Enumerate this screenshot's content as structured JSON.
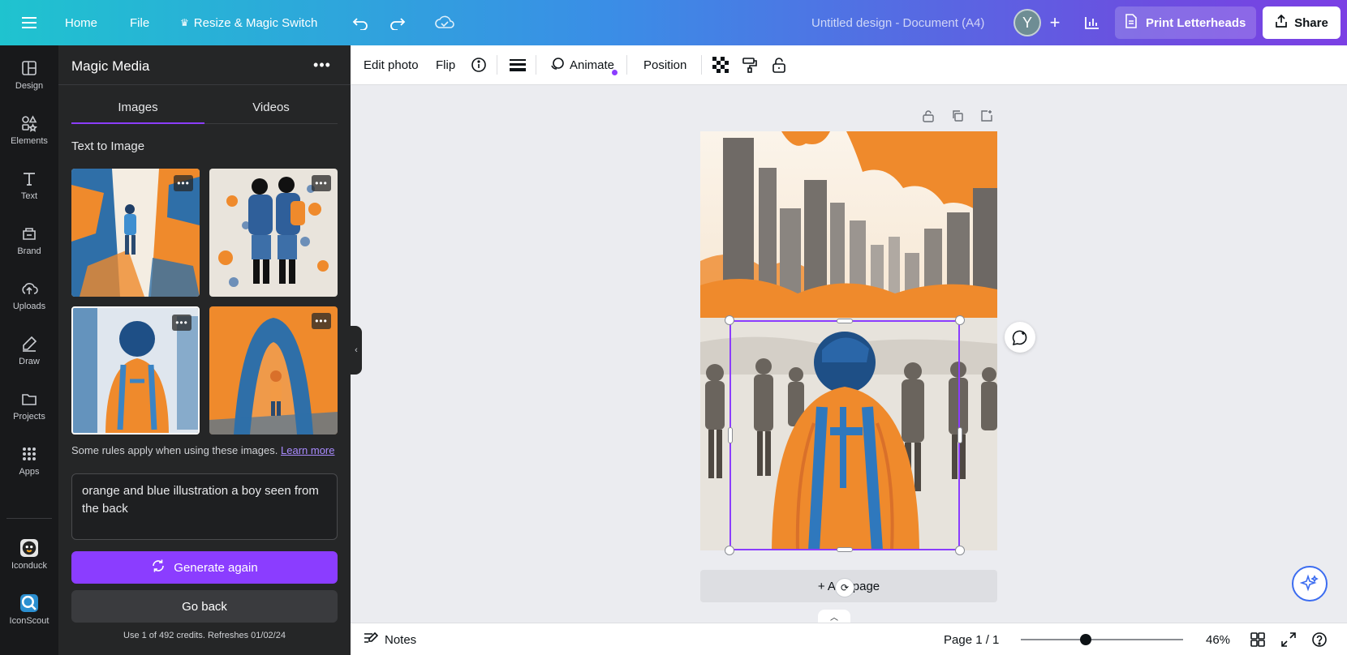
{
  "topbar": {
    "home": "Home",
    "file": "File",
    "resize": "Resize & Magic Switch",
    "doc_title": "Untitled design - Document (A4)",
    "avatar_initial": "Y",
    "print": "Print Letterheads",
    "share": "Share"
  },
  "rail": {
    "items": [
      {
        "label": "Design",
        "icon": "design-icon"
      },
      {
        "label": "Elements",
        "icon": "elements-icon"
      },
      {
        "label": "Text",
        "icon": "text-icon"
      },
      {
        "label": "Brand",
        "icon": "brand-icon"
      },
      {
        "label": "Uploads",
        "icon": "uploads-icon"
      },
      {
        "label": "Draw",
        "icon": "draw-icon"
      },
      {
        "label": "Projects",
        "icon": "projects-icon"
      },
      {
        "label": "Apps",
        "icon": "apps-icon"
      },
      {
        "label": "Iconduck",
        "icon": "iconduck-icon"
      },
      {
        "label": "IconScout",
        "icon": "iconscout-icon"
      }
    ]
  },
  "panel": {
    "title": "Magic Media",
    "tabs": [
      {
        "label": "Images",
        "active": true
      },
      {
        "label": "Videos",
        "active": false
      }
    ],
    "section_title": "Text to Image",
    "rules_text": "Some rules apply when using these images.",
    "rules_link": "Learn more",
    "prompt": "orange and blue illustration a boy seen from the back",
    "generate_label": "Generate again",
    "back_label": "Go back",
    "credits": "Use 1 of 492 credits. Refreshes 01/02/24"
  },
  "toolbar": {
    "edit_photo": "Edit photo",
    "flip": "Flip",
    "animate": "Animate",
    "position": "Position"
  },
  "canvas": {
    "add_page": "+ Add page"
  },
  "bottom": {
    "notes": "Notes",
    "page_indicator": "Page 1 / 1",
    "zoom": "46%",
    "zoom_fraction": 0.4
  },
  "colors": {
    "accent": "#8b3dff",
    "rail_bg": "#18191b",
    "panel_bg": "#252627",
    "orange": "#ef8a2c",
    "blue": "#2b6fa8"
  }
}
